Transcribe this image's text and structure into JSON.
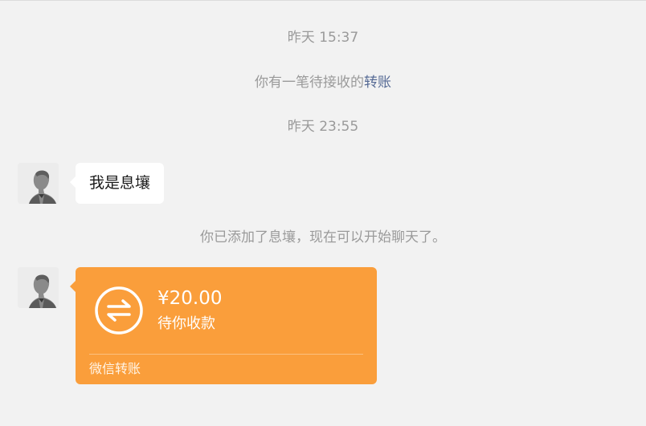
{
  "messages": {
    "time1": "昨天 15:37",
    "pending_notice_prefix": "你有一笔待接收的",
    "pending_notice_link": "转账",
    "time2": "昨天 23:55",
    "greeting_bubble": "我是息壤",
    "added_notice": "你已添加了息壤，现在可以开始聊天了。"
  },
  "transfer": {
    "amount": "¥20.00",
    "status": "待你收款",
    "footer": "微信转账",
    "color": "#fa9e3b"
  },
  "icons": {
    "avatar": "portrait-avatar",
    "transfer": "transfer-arrows-icon"
  }
}
